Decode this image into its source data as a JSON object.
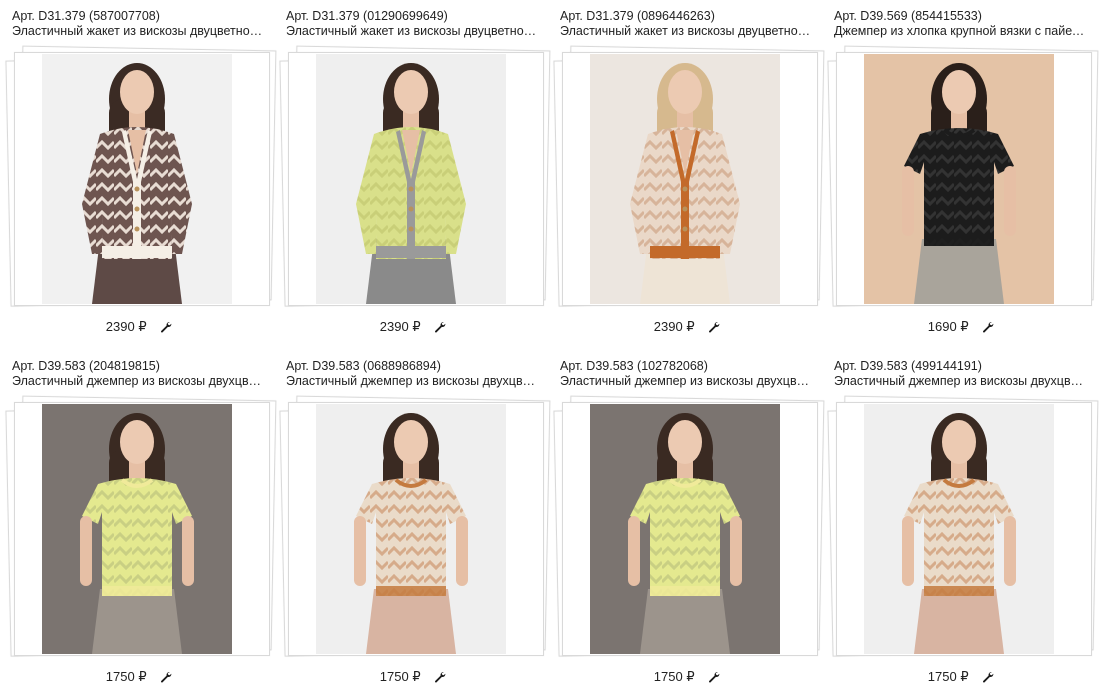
{
  "products": [
    {
      "article": "Арт. D31.379 (587007708)",
      "name": "Эластичный жакет из вискозы двуцветной вязки",
      "price": "2390 ₽",
      "bg": "#f1f1f1",
      "garment": "#6e5550",
      "trim": "#f5efe6",
      "pattern": "#e8dcd3",
      "pants": "#5e4a46",
      "hair": "#3b2b24",
      "type": "cardigan"
    },
    {
      "article": "Арт. D31.379 (01290699649)",
      "name": "Эластичный жакет из вискозы двуцветной вязки",
      "price": "2390 ₽",
      "bg": "#efefef",
      "garment": "#d9e08a",
      "trim": "#9a9a9a",
      "pattern": "#c9cf78",
      "pants": "#8a8a8a",
      "hair": "#3a2a22",
      "type": "cardigan"
    },
    {
      "article": "Арт. D31.379 (0896446263)",
      "name": "Эластичный жакет из вискозы двуцветной вязки",
      "price": "2390 ₽",
      "bg": "#ece6e0",
      "garment": "#ead8c8",
      "trim": "#c36a2a",
      "pattern": "#d7b49a",
      "pants": "#eee4d6",
      "hair": "#d6b98e",
      "type": "cardigan"
    },
    {
      "article": "Арт. D39.569 (854415533)",
      "name": "Джемпер из хлопка крупной вязки с пайетками",
      "price": "1690 ₽",
      "bg": "#e4c3a6",
      "garment": "#1c1c1c",
      "trim": "#1c1c1c",
      "pattern": "#333333",
      "pants": "#a9a49b",
      "hair": "#2a1f1a",
      "type": "tee"
    },
    {
      "article": "Арт. D39.583 (204819815)",
      "name": "Эластичный джемпер из вискозы двухцветной вязки",
      "price": "1750 ₽",
      "bg": "#7b7470",
      "garment": "#e4e98f",
      "trim": "#f0ea9a",
      "pattern": "#c9cf83",
      "pants": "#9c948c",
      "hair": "#3a2a22",
      "type": "tee"
    },
    {
      "article": "Арт. D39.583 (0688986894)",
      "name": "Эластичный джемпер из вискозы двухцветной вязки",
      "price": "1750 ₽",
      "bg": "#efefef",
      "garment": "#eadbc9",
      "trim": "#c47a3e",
      "pattern": "#d6ab8a",
      "pants": "#d8b4a2",
      "hair": "#3a2a22",
      "type": "tee"
    },
    {
      "article": "Арт. D39.583 (102782068)",
      "name": "Эластичный джемпер из вискозы двухцветной вязки",
      "price": "1750 ₽",
      "bg": "#7b7470",
      "garment": "#e4e98f",
      "trim": "#f0ea9a",
      "pattern": "#c9cf83",
      "pants": "#9c948c",
      "hair": "#3a2a22",
      "type": "tee"
    },
    {
      "article": "Арт. D39.583 (499144191)",
      "name": "Эластичный джемпер из вискозы двухцветной вязки",
      "price": "1750 ₽",
      "bg": "#efefef",
      "garment": "#eadbc9",
      "trim": "#c47a3e",
      "pattern": "#d6ab8a",
      "pants": "#d8b4a2",
      "hair": "#3a2a22",
      "type": "tee"
    }
  ],
  "icons": {
    "edit": "wrench-icon"
  }
}
